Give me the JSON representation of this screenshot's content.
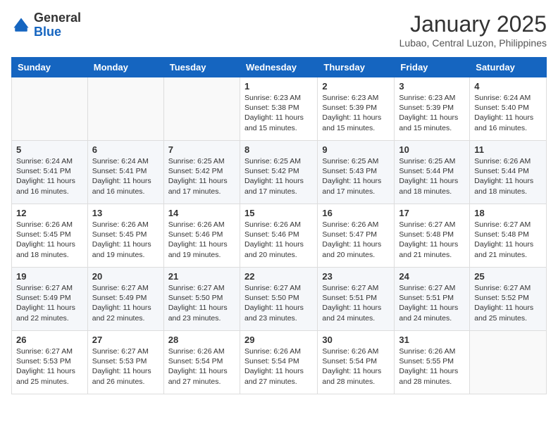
{
  "header": {
    "logo_general": "General",
    "logo_blue": "Blue",
    "title": "January 2025",
    "location": "Lubao, Central Luzon, Philippines"
  },
  "weekdays": [
    "Sunday",
    "Monday",
    "Tuesday",
    "Wednesday",
    "Thursday",
    "Friday",
    "Saturday"
  ],
  "weeks": [
    [
      {
        "day": "",
        "text": ""
      },
      {
        "day": "",
        "text": ""
      },
      {
        "day": "",
        "text": ""
      },
      {
        "day": "1",
        "text": "Sunrise: 6:23 AM\nSunset: 5:38 PM\nDaylight: 11 hours and 15 minutes."
      },
      {
        "day": "2",
        "text": "Sunrise: 6:23 AM\nSunset: 5:39 PM\nDaylight: 11 hours and 15 minutes."
      },
      {
        "day": "3",
        "text": "Sunrise: 6:23 AM\nSunset: 5:39 PM\nDaylight: 11 hours and 15 minutes."
      },
      {
        "day": "4",
        "text": "Sunrise: 6:24 AM\nSunset: 5:40 PM\nDaylight: 11 hours and 16 minutes."
      }
    ],
    [
      {
        "day": "5",
        "text": "Sunrise: 6:24 AM\nSunset: 5:41 PM\nDaylight: 11 hours and 16 minutes."
      },
      {
        "day": "6",
        "text": "Sunrise: 6:24 AM\nSunset: 5:41 PM\nDaylight: 11 hours and 16 minutes."
      },
      {
        "day": "7",
        "text": "Sunrise: 6:25 AM\nSunset: 5:42 PM\nDaylight: 11 hours and 17 minutes."
      },
      {
        "day": "8",
        "text": "Sunrise: 6:25 AM\nSunset: 5:42 PM\nDaylight: 11 hours and 17 minutes."
      },
      {
        "day": "9",
        "text": "Sunrise: 6:25 AM\nSunset: 5:43 PM\nDaylight: 11 hours and 17 minutes."
      },
      {
        "day": "10",
        "text": "Sunrise: 6:25 AM\nSunset: 5:44 PM\nDaylight: 11 hours and 18 minutes."
      },
      {
        "day": "11",
        "text": "Sunrise: 6:26 AM\nSunset: 5:44 PM\nDaylight: 11 hours and 18 minutes."
      }
    ],
    [
      {
        "day": "12",
        "text": "Sunrise: 6:26 AM\nSunset: 5:45 PM\nDaylight: 11 hours and 18 minutes."
      },
      {
        "day": "13",
        "text": "Sunrise: 6:26 AM\nSunset: 5:45 PM\nDaylight: 11 hours and 19 minutes."
      },
      {
        "day": "14",
        "text": "Sunrise: 6:26 AM\nSunset: 5:46 PM\nDaylight: 11 hours and 19 minutes."
      },
      {
        "day": "15",
        "text": "Sunrise: 6:26 AM\nSunset: 5:46 PM\nDaylight: 11 hours and 20 minutes."
      },
      {
        "day": "16",
        "text": "Sunrise: 6:26 AM\nSunset: 5:47 PM\nDaylight: 11 hours and 20 minutes."
      },
      {
        "day": "17",
        "text": "Sunrise: 6:27 AM\nSunset: 5:48 PM\nDaylight: 11 hours and 21 minutes."
      },
      {
        "day": "18",
        "text": "Sunrise: 6:27 AM\nSunset: 5:48 PM\nDaylight: 11 hours and 21 minutes."
      }
    ],
    [
      {
        "day": "19",
        "text": "Sunrise: 6:27 AM\nSunset: 5:49 PM\nDaylight: 11 hours and 22 minutes."
      },
      {
        "day": "20",
        "text": "Sunrise: 6:27 AM\nSunset: 5:49 PM\nDaylight: 11 hours and 22 minutes."
      },
      {
        "day": "21",
        "text": "Sunrise: 6:27 AM\nSunset: 5:50 PM\nDaylight: 11 hours and 23 minutes."
      },
      {
        "day": "22",
        "text": "Sunrise: 6:27 AM\nSunset: 5:50 PM\nDaylight: 11 hours and 23 minutes."
      },
      {
        "day": "23",
        "text": "Sunrise: 6:27 AM\nSunset: 5:51 PM\nDaylight: 11 hours and 24 minutes."
      },
      {
        "day": "24",
        "text": "Sunrise: 6:27 AM\nSunset: 5:51 PM\nDaylight: 11 hours and 24 minutes."
      },
      {
        "day": "25",
        "text": "Sunrise: 6:27 AM\nSunset: 5:52 PM\nDaylight: 11 hours and 25 minutes."
      }
    ],
    [
      {
        "day": "26",
        "text": "Sunrise: 6:27 AM\nSunset: 5:53 PM\nDaylight: 11 hours and 25 minutes."
      },
      {
        "day": "27",
        "text": "Sunrise: 6:27 AM\nSunset: 5:53 PM\nDaylight: 11 hours and 26 minutes."
      },
      {
        "day": "28",
        "text": "Sunrise: 6:26 AM\nSunset: 5:54 PM\nDaylight: 11 hours and 27 minutes."
      },
      {
        "day": "29",
        "text": "Sunrise: 6:26 AM\nSunset: 5:54 PM\nDaylight: 11 hours and 27 minutes."
      },
      {
        "day": "30",
        "text": "Sunrise: 6:26 AM\nSunset: 5:54 PM\nDaylight: 11 hours and 28 minutes."
      },
      {
        "day": "31",
        "text": "Sunrise: 6:26 AM\nSunset: 5:55 PM\nDaylight: 11 hours and 28 minutes."
      },
      {
        "day": "",
        "text": ""
      }
    ]
  ]
}
